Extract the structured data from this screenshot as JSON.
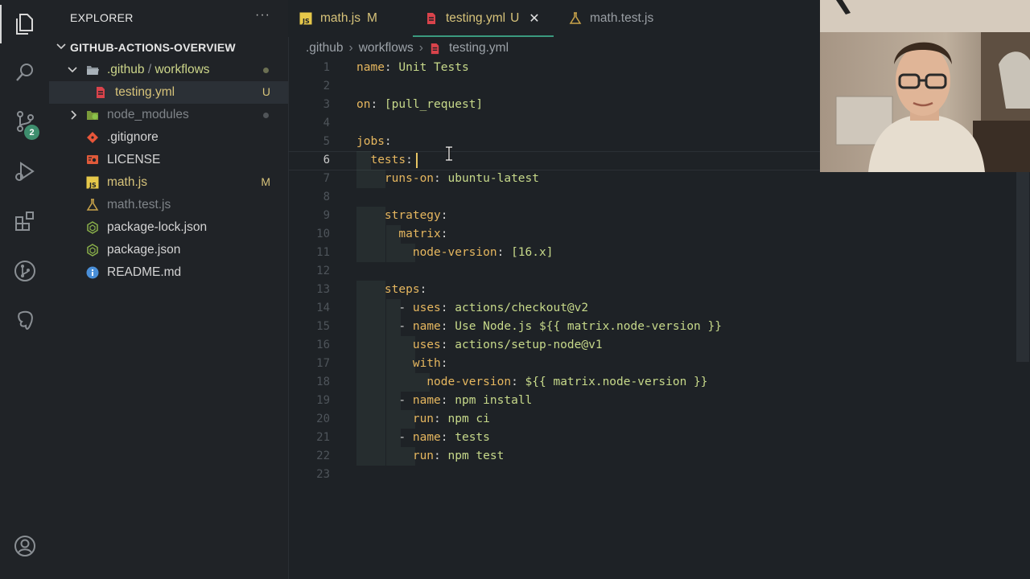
{
  "sidebar": {
    "title": "EXPLORER",
    "more": "···",
    "project": "GITHUB-ACTIONS-OVERVIEW",
    "items": [
      {
        "name": ".github",
        "suffix": "workflows",
        "sep": "/",
        "type": "folder-open",
        "status": ""
      },
      {
        "name": "testing.yml",
        "type": "yml",
        "status": "U"
      },
      {
        "name": "node_modules",
        "type": "folder",
        "status": ""
      },
      {
        "name": ".gitignore",
        "type": "git",
        "status": ""
      },
      {
        "name": "LICENSE",
        "type": "license",
        "status": ""
      },
      {
        "name": "math.js",
        "type": "js",
        "status": "M"
      },
      {
        "name": "math.test.js",
        "type": "test",
        "status": ""
      },
      {
        "name": "package-lock.json",
        "type": "npm",
        "status": ""
      },
      {
        "name": "package.json",
        "type": "npm",
        "status": ""
      },
      {
        "name": "README.md",
        "type": "info",
        "status": ""
      }
    ]
  },
  "activity": {
    "scm_badge": "2",
    "icons": [
      "files-icon",
      "search-icon",
      "source-control-icon",
      "run-debug-icon",
      "extensions-icon",
      "git-graph-icon",
      "postgres-icon",
      "account-icon"
    ]
  },
  "tabs": [
    {
      "label": "math.js",
      "status": "M",
      "icon": "js"
    },
    {
      "label": "testing.yml",
      "status": "U",
      "icon": "yml",
      "active": true,
      "close": "✕"
    },
    {
      "label": "math.test.js",
      "status": "",
      "icon": "test"
    }
  ],
  "breadcrumb": [
    ".github",
    "workflows",
    "testing.yml"
  ],
  "editor": {
    "current_line": 6,
    "lines": [
      "name: Unit Tests",
      "",
      "on: [pull_request]",
      "",
      "jobs:",
      "  tests:",
      "    runs-on: ubuntu-latest",
      "",
      "    strategy:",
      "      matrix:",
      "        node-version: [16.x]",
      "",
      "    steps:",
      "      - uses: actions/checkout@v2",
      "      - name: Use Node.js ${{ matrix.node-version }}",
      "        uses: actions/setup-node@v1",
      "        with:",
      "          node-version: ${{ matrix.node-version }}",
      "      - name: npm install",
      "        run: npm ci",
      "      - name: tests",
      "        run: npm test",
      ""
    ]
  },
  "colors": {
    "key": "#e6b75f",
    "value": "#c7d98a",
    "accent": "#3b9a7f",
    "modified": "#d7c37a"
  }
}
